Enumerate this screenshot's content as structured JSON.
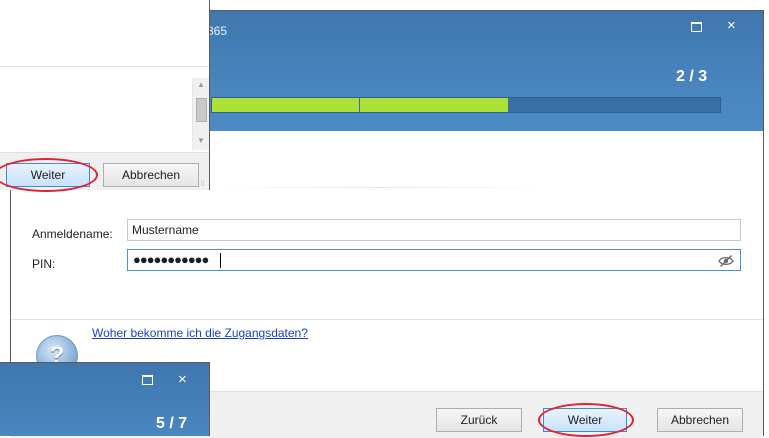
{
  "main_window": {
    "title_fragment": "365",
    "step": "2 / 3",
    "progress": {
      "completed_segments": 2,
      "total_segments": 3,
      "fraction": 0.58
    },
    "form": {
      "login_label": "Anmeldename:",
      "login_value": "Mustername",
      "pin_label": "PIN:",
      "pin_masked": "●●●●●●●●●●●"
    },
    "help_link": "Woher bekomme ich die Zugangsdaten?",
    "help_icon_glyph": "?",
    "buttons": {
      "back": "Zurück",
      "next": "Weiter",
      "cancel": "Abbrechen"
    },
    "title_controls": {
      "maximize": "maximize-icon",
      "close": "×"
    }
  },
  "top_left_window": {
    "buttons": {
      "next": "Weiter",
      "cancel": "Abbrechen"
    }
  },
  "bottom_left_window": {
    "step": "5 / 7",
    "title_controls": {
      "maximize": "maximize-icon",
      "close": "×"
    }
  },
  "colors": {
    "header_blue": "#4a86c1",
    "progress_green": "#aee03a",
    "highlight_red": "#e0232e",
    "link_blue": "#1a3fc4"
  }
}
